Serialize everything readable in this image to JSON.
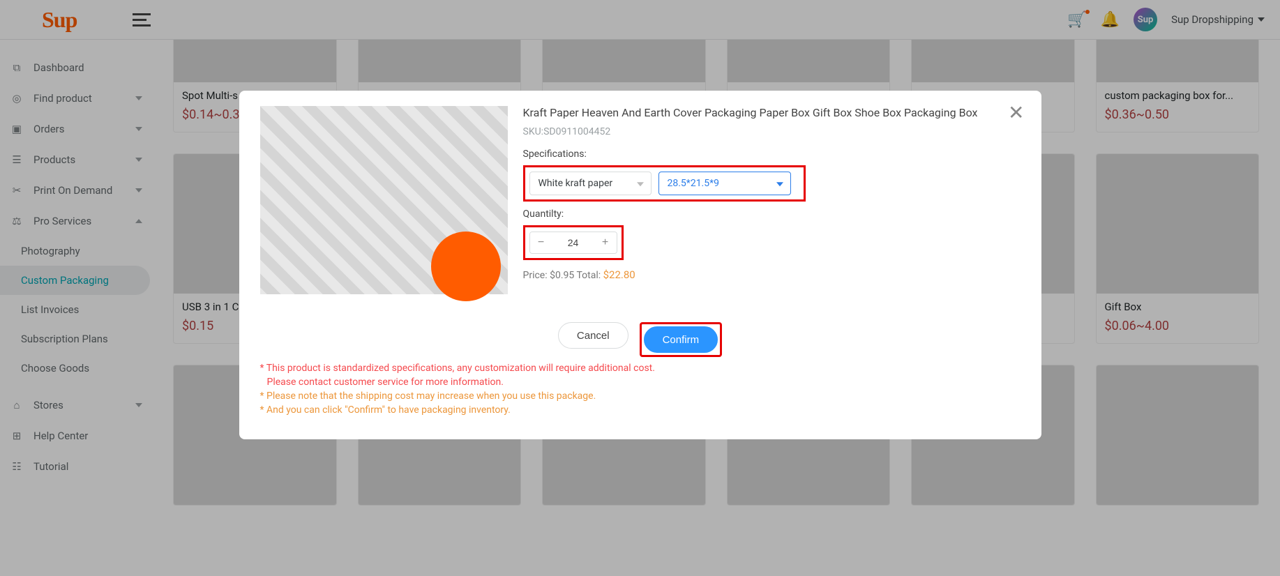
{
  "header": {
    "logo": "Sup",
    "avatar_text": "Sup",
    "account_name": "Sup Dropshipping"
  },
  "sidebar": {
    "items": [
      {
        "icon": "dashboard",
        "label": "Dashboard",
        "expandable": false
      },
      {
        "icon": "search",
        "label": "Find product",
        "expandable": true
      },
      {
        "icon": "orders",
        "label": "Orders",
        "expandable": true
      },
      {
        "icon": "products",
        "label": "Products",
        "expandable": true
      },
      {
        "icon": "pod",
        "label": "Print On Demand",
        "expandable": true
      },
      {
        "icon": "pro",
        "label": "Pro Services",
        "expandable": true,
        "open": true
      }
    ],
    "pro_sub": [
      "Photography",
      "Custom Packaging",
      "List Invoices",
      "Subscription Plans",
      "Choose Goods"
    ],
    "footer_items": [
      {
        "icon": "stores",
        "label": "Stores",
        "expandable": true
      },
      {
        "icon": "help",
        "label": "Help Center",
        "expandable": false
      },
      {
        "icon": "tutorial",
        "label": "Tutorial",
        "expandable": false
      }
    ],
    "active_sub": "Custom Packaging"
  },
  "products_row1": [
    {
      "title": "Spot Multi-s",
      "price": "$0.14~0.3"
    },
    {
      "title": "",
      "price": ""
    },
    {
      "title": "",
      "price": ""
    },
    {
      "title": "",
      "price": ""
    },
    {
      "title": "",
      "price": ""
    },
    {
      "title": "custom packaging box for...",
      "price": "$0.36~0.50"
    }
  ],
  "products_row2": [
    {
      "title": "USB 3 in 1 C",
      "price": "$0.15"
    },
    {
      "title": "",
      "price": ""
    },
    {
      "title": "",
      "price": ""
    },
    {
      "title": "",
      "price": ""
    },
    {
      "title": "",
      "price": ""
    },
    {
      "title": "Gift Box",
      "price": "$0.06~4.00"
    }
  ],
  "modal": {
    "title": "Kraft Paper Heaven And Earth Cover Packaging Paper Box Gift Box Shoe Box Packaging Box",
    "sku_label": "SKU:",
    "sku_value": "SD0911004452",
    "spec_label": "Specifications:",
    "spec1": "White kraft paper",
    "spec2": "28.5*21.5*9",
    "qty_label": "Quantilty:",
    "qty_value": "24",
    "price_label": "Price:",
    "price_unit": "$0.95",
    "total_label": "Total:",
    "total_value": "$22.80",
    "cancel": "Cancel",
    "confirm": "Confirm",
    "note1_a": "* This product is standardized specifications, any customization will require additional cost.",
    "note1_b": "Please contact customer service for more information.",
    "note2": "* Please note that the shipping cost may increase when you use this package.",
    "note3": "* And you can click \"Confirm\" to have packaging inventory."
  }
}
